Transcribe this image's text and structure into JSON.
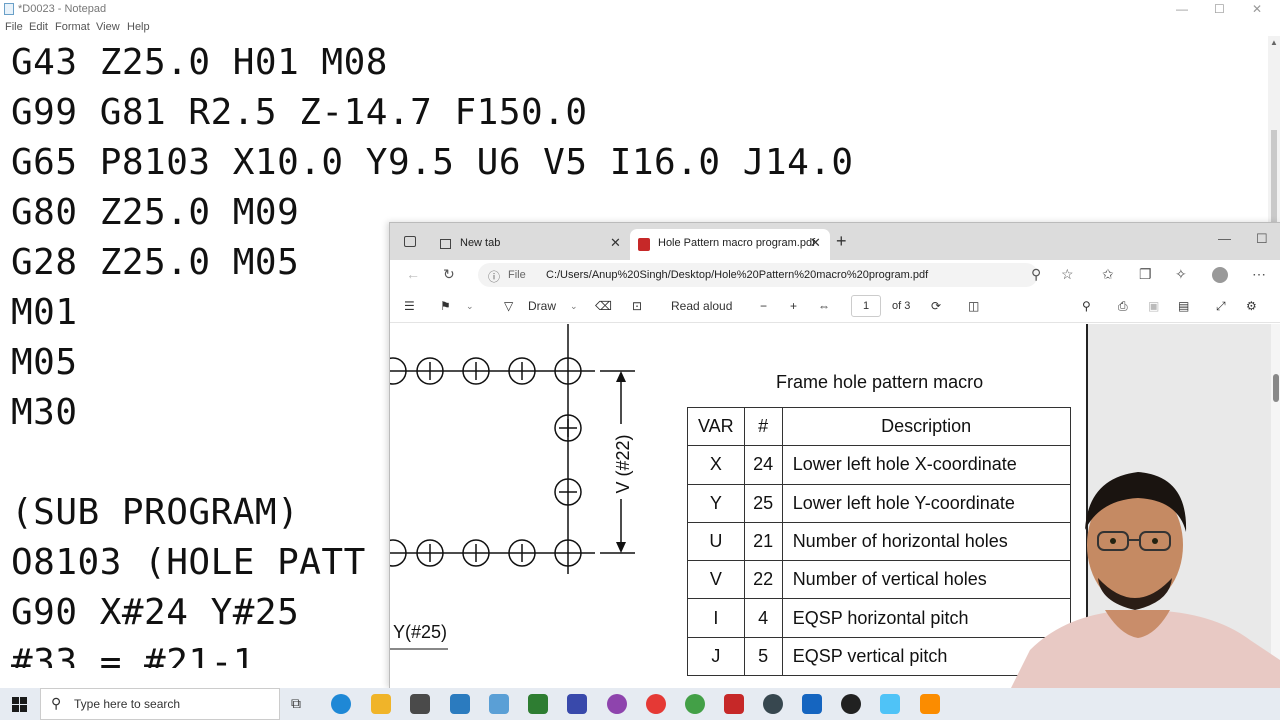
{
  "notepad": {
    "title": "*D0023 - Notepad",
    "menu": [
      "File",
      "Edit",
      "Format",
      "View",
      "Help"
    ],
    "window_controls": {
      "minimize": "—",
      "maximize": "☐",
      "close": "✕"
    },
    "lines": [
      "G43 Z25.0 H01 M08",
      "G99 G81 R2.5 Z-14.7 F150.0",
      "G65 P8103 X10.0 Y9.5 U6 V5 I16.0 J14.0",
      "G80 Z25.0 M09",
      "G28 Z25.0 M05",
      "M01",
      "M05",
      "M30",
      "",
      "(SUB PROGRAM)",
      "O8103 (HOLE PATT",
      "G90 X#24 Y#25",
      "#33 = #21-1"
    ]
  },
  "browser": {
    "tabs": [
      {
        "label": "New tab",
        "active": false
      },
      {
        "label": "Hole Pattern macro program.pdf",
        "active": true
      }
    ],
    "new_tab_symbol": "+",
    "address": {
      "scheme": "File",
      "url": "C:/Users/Anup%20Singh/Desktop/Hole%20Pattern%20macro%20program.pdf"
    },
    "pdf_toolbar": {
      "draw_label": "Draw",
      "read_aloud_label": "Read aloud",
      "zoom_out": "−",
      "zoom_in": "+",
      "page_current": "1",
      "page_total": "of 3"
    }
  },
  "pdf_content": {
    "drawing_labels": {
      "v_dim": "V (#22)",
      "y_dim": "Y(#25)"
    },
    "table_title": "Frame hole pattern macro",
    "table_headers": [
      "VAR",
      "#",
      "Description"
    ],
    "table_rows": [
      {
        "var": "X",
        "num": "24",
        "desc": "Lower left hole X-coordinate"
      },
      {
        "var": "Y",
        "num": "25",
        "desc": "Lower left hole Y-coordinate"
      },
      {
        "var": "U",
        "num": "21",
        "desc": "Number of horizontal holes"
      },
      {
        "var": "V",
        "num": "22",
        "desc": "Number of vertical holes"
      },
      {
        "var": "I",
        "num": "4",
        "desc": "EQSP horizontal pitch"
      },
      {
        "var": "J",
        "num": "5",
        "desc": "EQSP vertical pitch"
      }
    ]
  },
  "taskbar": {
    "search_placeholder": "Type here to search"
  }
}
